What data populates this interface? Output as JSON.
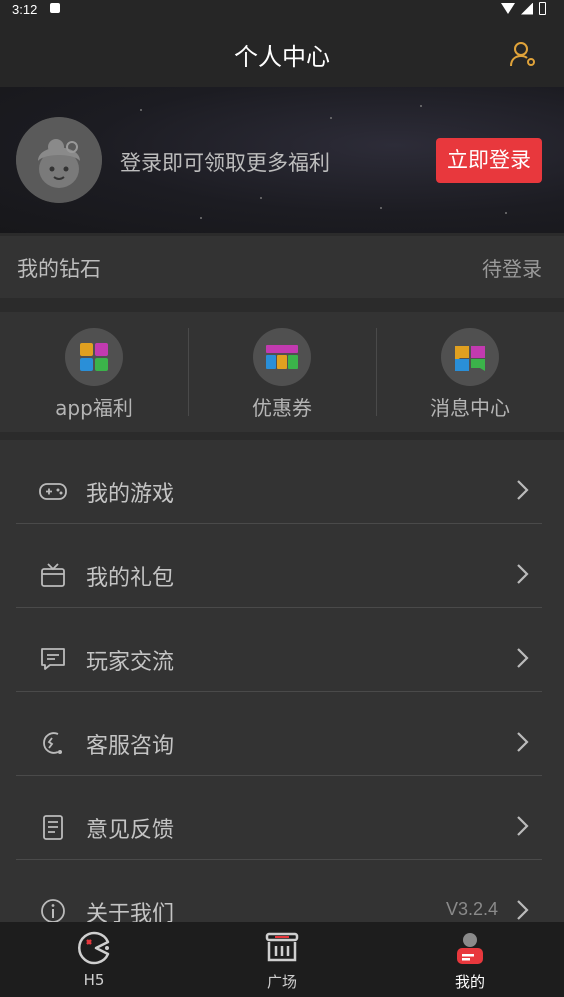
{
  "status_bar": {
    "time": "3:12"
  },
  "header": {
    "title": "个人中心"
  },
  "hero": {
    "promo_text": "登录即可领取更多福利",
    "login_button": "立即登录"
  },
  "diamonds": {
    "label": "我的钻石",
    "status": "待登录"
  },
  "quick_actions": [
    {
      "label": "app福利",
      "icon": "app-welfare-icon"
    },
    {
      "label": "优惠券",
      "icon": "coupon-icon"
    },
    {
      "label": "消息中心",
      "icon": "message-center-icon"
    }
  ],
  "menu": [
    {
      "label": "我的游戏",
      "icon": "gamepad-icon",
      "value": ""
    },
    {
      "label": "我的礼包",
      "icon": "gift-icon",
      "value": ""
    },
    {
      "label": "玩家交流",
      "icon": "chat-icon",
      "value": ""
    },
    {
      "label": "客服咨询",
      "icon": "headset-icon",
      "value": ""
    },
    {
      "label": "意见反馈",
      "icon": "feedback-icon",
      "value": ""
    },
    {
      "label": "关于我们",
      "icon": "info-icon",
      "value": "V3.2.4"
    }
  ],
  "tabs": [
    {
      "label": "H5",
      "icon": "h5-icon",
      "active": false
    },
    {
      "label": "广场",
      "icon": "square-icon",
      "active": false
    },
    {
      "label": "我的",
      "icon": "profile-icon",
      "active": true
    }
  ],
  "colors": {
    "accent": "#e8383d",
    "header_icon": "#e0a33a",
    "background": "#2b2b2b"
  }
}
